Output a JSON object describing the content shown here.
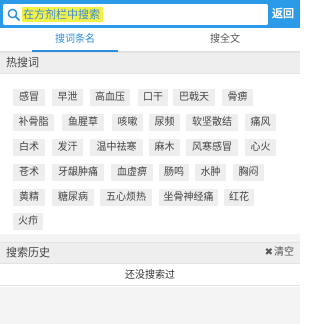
{
  "search": {
    "placeholder": "在方剂栏中搜索",
    "back_label": "返回"
  },
  "tabs": [
    {
      "label": "搜词条名",
      "active": true
    },
    {
      "label": "搜全文",
      "active": false
    }
  ],
  "hot": {
    "title": "热搜词",
    "rows": [
      [
        "感冒",
        "早泄",
        "高血压",
        "口干",
        "巴戟天",
        "骨痹"
      ],
      [
        "补骨脂",
        "鱼腥草",
        "咳嗽",
        "尿频",
        "软坚散结",
        "痛风"
      ],
      [
        "白术",
        "发汗",
        "温中祛寒",
        "麻木",
        "风寒感冒",
        "心火"
      ],
      [
        "苍术",
        "牙龈肿痛",
        "血虚痹",
        "肠鸣",
        "水肿",
        "胸闷"
      ],
      [
        "黄精",
        "糖尿病",
        "五心烦热",
        "坐骨神经痛",
        "红花"
      ],
      [
        "火疖"
      ]
    ]
  },
  "history": {
    "title": "搜索历史",
    "clear_label": "清空",
    "empty_text": "还没搜索过"
  },
  "colors": {
    "accent": "#2b9be8",
    "highlight": "#f3f148"
  }
}
